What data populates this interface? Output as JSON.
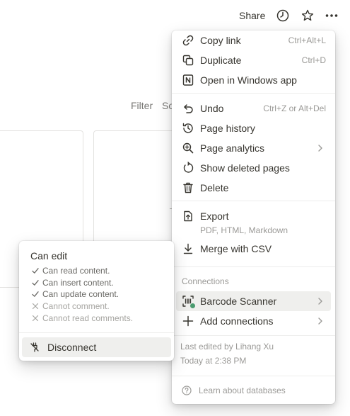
{
  "topbar": {
    "share_label": "Share",
    "icons": [
      "clock-icon",
      "star-icon",
      "more-icon"
    ]
  },
  "background": {
    "filter_label": "Filter",
    "sort_label": "So"
  },
  "menu": {
    "items": [
      {
        "label": "Copy link",
        "shortcut": "Ctrl+Alt+L",
        "icon": "link-icon"
      },
      {
        "label": "Duplicate",
        "shortcut": "Ctrl+D",
        "icon": "duplicate-icon"
      },
      {
        "label": "Open in Windows app",
        "icon": "notion-app-icon"
      },
      {
        "label": "Undo",
        "shortcut": "Ctrl+Z or Alt+Del",
        "icon": "undo-icon"
      },
      {
        "label": "Page history",
        "icon": "history-icon"
      },
      {
        "label": "Page analytics",
        "icon": "analytics-icon"
      },
      {
        "label": "Show deleted pages",
        "icon": "restore-icon"
      },
      {
        "label": "Delete",
        "icon": "trash-icon"
      },
      {
        "label": "Export",
        "sublabel": "PDF, HTML, Markdown",
        "icon": "export-icon"
      },
      {
        "label": "Merge with CSV",
        "icon": "download-icon"
      }
    ],
    "connections": {
      "heading": "Connections",
      "items": [
        {
          "label": "Barcode Scanner",
          "icon": "barcode-icon",
          "status_color": "#4a9b6f"
        },
        {
          "label": "Add connections",
          "icon": "plus-icon"
        }
      ]
    },
    "last_edited_by": "Last edited by Lihang Xu",
    "last_edited_time": "Today at 2:38 PM",
    "learn_label": "Learn about databases"
  },
  "permissions": {
    "title": "Can edit",
    "items": [
      {
        "text": "Can read content.",
        "allowed": true
      },
      {
        "text": "Can insert content.",
        "allowed": true
      },
      {
        "text": "Can update content.",
        "allowed": true
      },
      {
        "text": "Cannot comment.",
        "allowed": false
      },
      {
        "text": "Cannot read comments.",
        "allowed": false
      }
    ],
    "disconnect_label": "Disconnect"
  },
  "colors": {
    "text": "#37352f",
    "muted": "#9b9a97",
    "hover": "#efefed",
    "status_green": "#4a9b6f"
  }
}
